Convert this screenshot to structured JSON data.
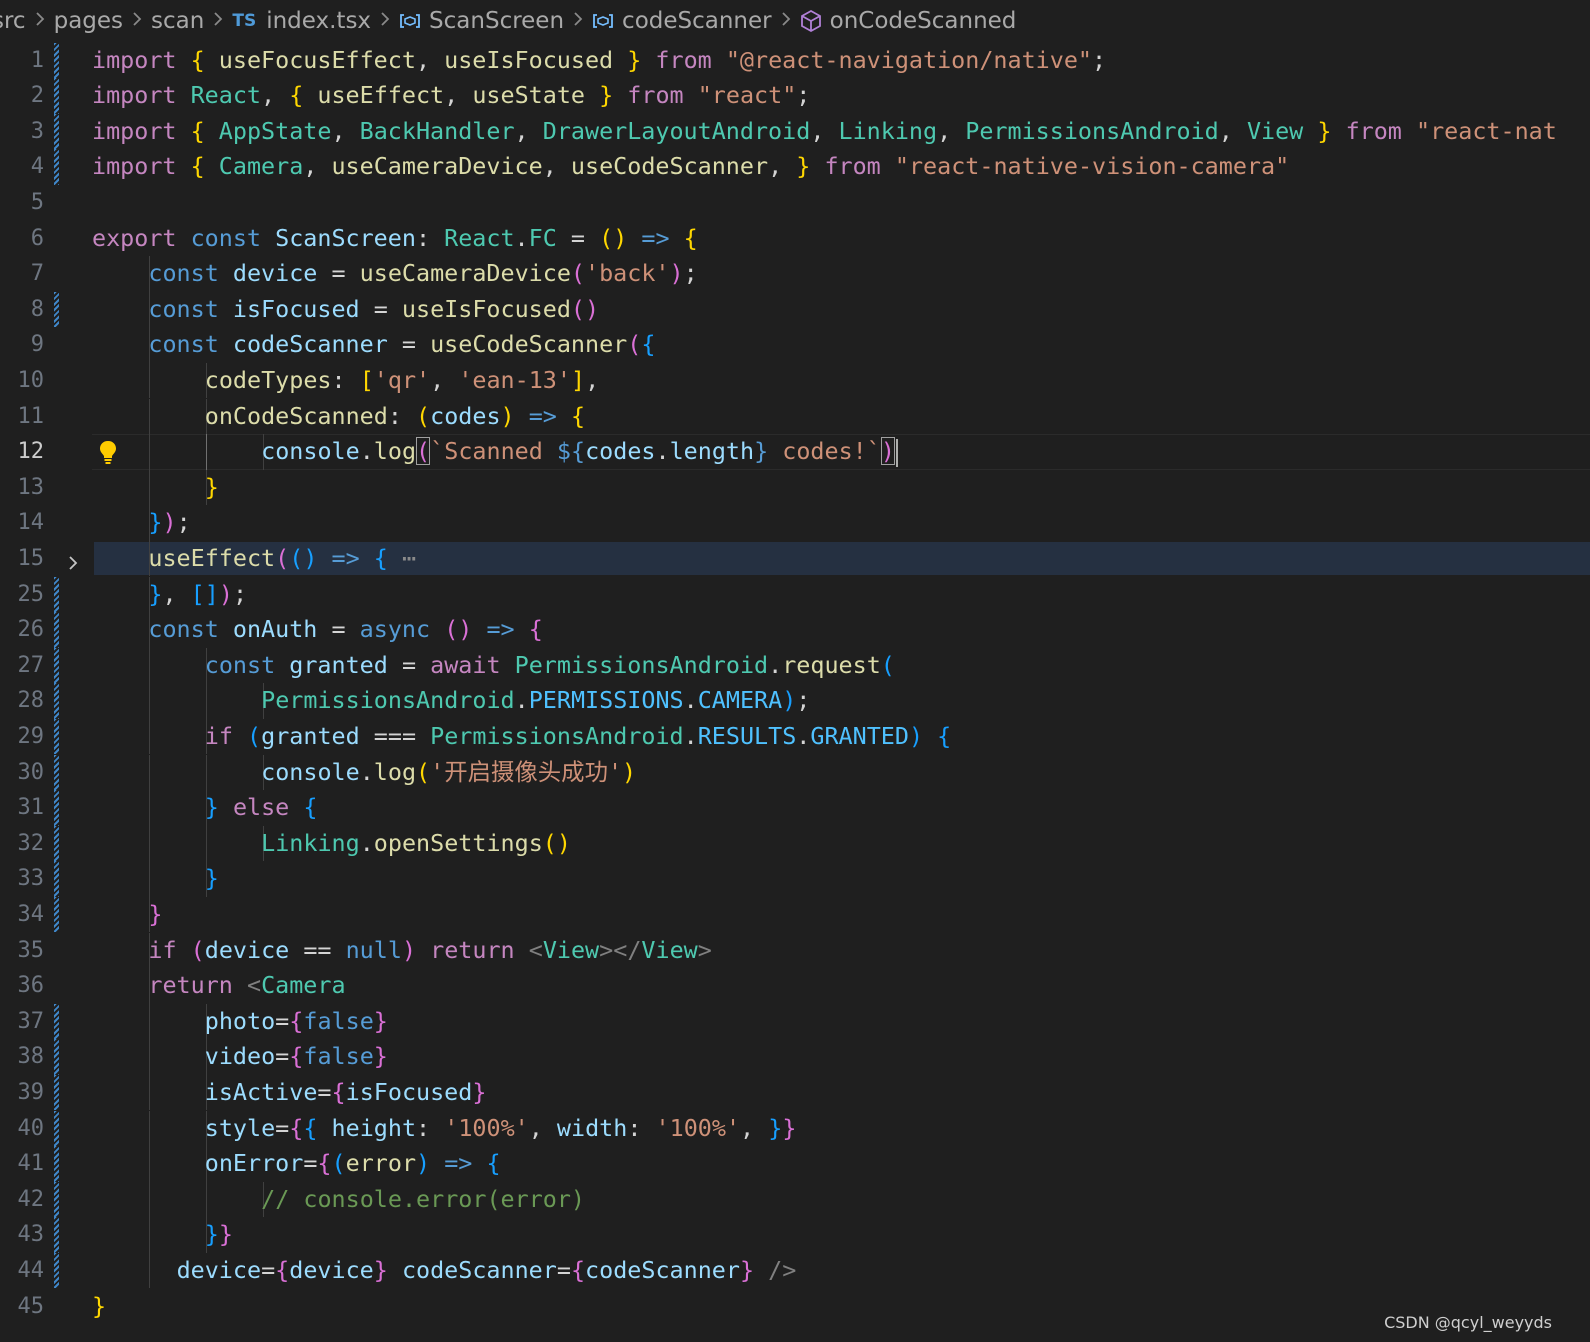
{
  "breadcrumb": {
    "items": [
      "src",
      "pages",
      "scan",
      "index.tsx",
      "ScanScreen",
      "codeScanner",
      "onCodeScanned"
    ],
    "file_type_icon": "TS"
  },
  "editor": {
    "current_line": 12,
    "lines": [
      {
        "n": "1",
        "code": "import { useFocusEffect, useIsFocused } from \"@react-navigation/native\";"
      },
      {
        "n": "2",
        "code": "import React, { useEffect, useState } from \"react\";"
      },
      {
        "n": "3",
        "code": "import { AppState, BackHandler, DrawerLayoutAndroid, Linking, PermissionsAndroid, View } from \"react-nat"
      },
      {
        "n": "4",
        "code": "import { Camera, useCameraDevice, useCodeScanner, } from \"react-native-vision-camera\""
      },
      {
        "n": "5",
        "code": ""
      },
      {
        "n": "6",
        "code": "export const ScanScreen: React.FC = () => {"
      },
      {
        "n": "7",
        "code": "    const device = useCameraDevice('back');"
      },
      {
        "n": "8",
        "code": "    const isFocused = useIsFocused()"
      },
      {
        "n": "9",
        "code": "    const codeScanner = useCodeScanner({"
      },
      {
        "n": "10",
        "code": "        codeTypes: ['qr', 'ean-13'],"
      },
      {
        "n": "11",
        "code": "        onCodeScanned: (codes) => {"
      },
      {
        "n": "12",
        "code": "            console.log(`Scanned ${codes.length} codes!`)"
      },
      {
        "n": "13",
        "code": "        }"
      },
      {
        "n": "14",
        "code": "    });"
      },
      {
        "n": "15",
        "code": "    useEffect(() => {⋯"
      },
      {
        "n": "25",
        "code": "    }, []);"
      },
      {
        "n": "26",
        "code": "    const onAuth = async () => {"
      },
      {
        "n": "27",
        "code": "        const granted = await PermissionsAndroid.request("
      },
      {
        "n": "28",
        "code": "            PermissionsAndroid.PERMISSIONS.CAMERA);"
      },
      {
        "n": "29",
        "code": "        if (granted === PermissionsAndroid.RESULTS.GRANTED) {"
      },
      {
        "n": "30",
        "code": "            console.log('开启摄像头成功')"
      },
      {
        "n": "31",
        "code": "        } else {"
      },
      {
        "n": "32",
        "code": "            Linking.openSettings()"
      },
      {
        "n": "33",
        "code": "        }"
      },
      {
        "n": "34",
        "code": "    }"
      },
      {
        "n": "35",
        "code": "    if (device == null) return <View></View>"
      },
      {
        "n": "36",
        "code": "    return <Camera"
      },
      {
        "n": "37",
        "code": "        photo={false}"
      },
      {
        "n": "38",
        "code": "        video={false}"
      },
      {
        "n": "39",
        "code": "        isActive={isFocused}"
      },
      {
        "n": "40",
        "code": "        style={{ height: '100%', width: '100%', }}"
      },
      {
        "n": "41",
        "code": "        onError={(error) => {"
      },
      {
        "n": "42",
        "code": "            // console.error(error)"
      },
      {
        "n": "43",
        "code": "        }}"
      },
      {
        "n": "44",
        "code": "      device={device} codeScanner={codeScanner} />"
      },
      {
        "n": "45",
        "code": "}"
      }
    ]
  },
  "watermark": "CSDN @qcyl_weyyds",
  "colors": {
    "background": "#1f1f1f",
    "keyword": "#c586c0",
    "storage": "#569cd6",
    "variable": "#9cdcfe",
    "function": "#dcdcaa",
    "string": "#ce9178",
    "type": "#4ec9b0",
    "comment": "#6a9955",
    "bracket_1": "#ffd700",
    "bracket_2": "#da70d6",
    "bracket_3": "#179fff"
  },
  "icons": [
    "chevron-right-icon",
    "typescript-file-icon",
    "symbol-variable-icon",
    "symbol-method-icon",
    "fold-chevron-icon",
    "lightbulb-icon"
  ]
}
